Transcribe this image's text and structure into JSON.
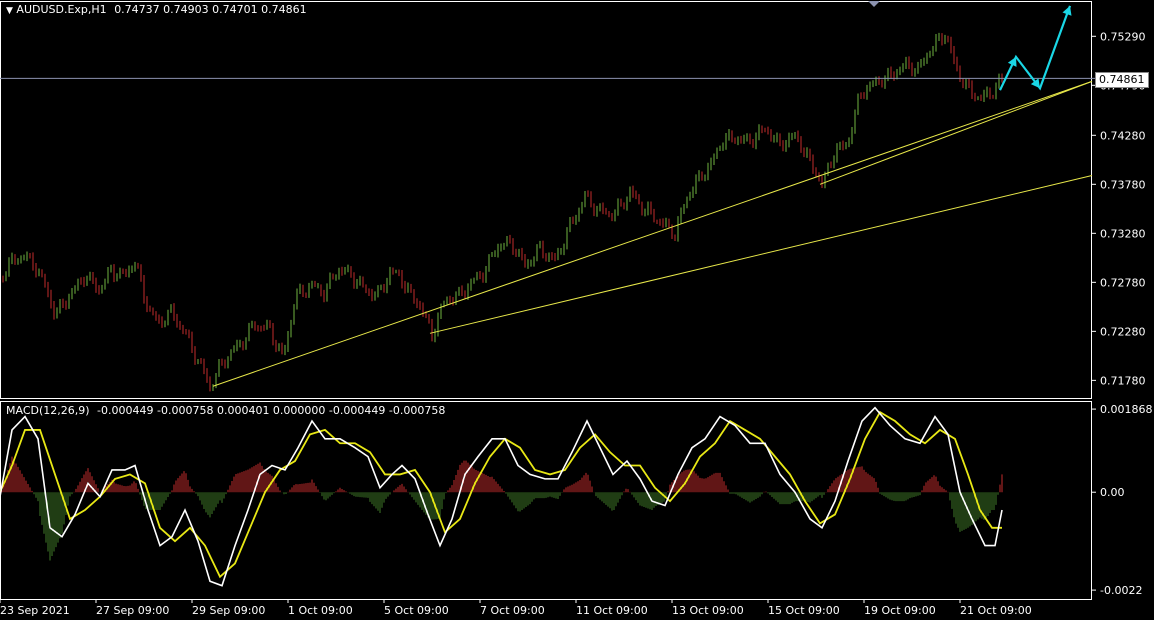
{
  "header": {
    "symbol_timeframe": "AUDUSD.Exp,H1",
    "ohlc": "0.74737 0.74903 0.74701 0.74861"
  },
  "macd_header": {
    "label": "MACD(12,26,9)",
    "values": "-0.000449 -0.000758 0.000401 0.000000 -0.000449 -0.000758"
  },
  "current_price": "0.74861",
  "colors": {
    "background": "#000000",
    "bull": "#6fb43f",
    "bear": "#c22b2b",
    "trendline": "#e8e84a",
    "bid_line": "#8c93b0",
    "arrow": "#1ad7e6",
    "macd_line": "#ffffff",
    "signal_line": "#e8e815",
    "hist_pos": "#c22b2b",
    "hist_neg": "#3f7a28",
    "frame": "#ffffff"
  },
  "chart_data": [
    {
      "type": "candlestick",
      "title": "AUDUSD.Exp,H1",
      "y_ticks": [
        "0.75290",
        "0.74790",
        "0.74280",
        "0.73780",
        "0.73280",
        "0.72780",
        "0.72280",
        "0.71780"
      ],
      "ylim": [
        0.716,
        0.7565
      ],
      "x_ticks": [
        "23 Sep 2021",
        "27 Sep 09:00",
        "29 Sep 09:00",
        "1 Oct 09:00",
        "5 Oct 09:00",
        "7 Oct 09:00",
        "11 Oct 09:00",
        "13 Oct 09:00",
        "15 Oct 09:00",
        "19 Oct 09:00",
        "21 Oct 09:00"
      ],
      "close_path": [
        [
          0,
          0.7282
        ],
        [
          12,
          0.73
        ],
        [
          25,
          0.7305
        ],
        [
          35,
          0.7295
        ],
        [
          45,
          0.7275
        ],
        [
          55,
          0.7245
        ],
        [
          70,
          0.7265
        ],
        [
          85,
          0.7285
        ],
        [
          100,
          0.727
        ],
        [
          110,
          0.729
        ],
        [
          125,
          0.7285
        ],
        [
          135,
          0.73
        ],
        [
          145,
          0.726
        ],
        [
          158,
          0.7235
        ],
        [
          170,
          0.7248
        ],
        [
          182,
          0.7232
        ],
        [
          195,
          0.7205
        ],
        [
          210,
          0.7172
        ],
        [
          225,
          0.72
        ],
        [
          240,
          0.7215
        ],
        [
          255,
          0.7235
        ],
        [
          270,
          0.723
        ],
        [
          283,
          0.72
        ],
        [
          295,
          0.7262
        ],
        [
          310,
          0.7275
        ],
        [
          325,
          0.7268
        ],
        [
          338,
          0.7292
        ],
        [
          352,
          0.7285
        ],
        [
          365,
          0.727
        ],
        [
          378,
          0.7265
        ],
        [
          390,
          0.7288
        ],
        [
          400,
          0.7285
        ],
        [
          410,
          0.7265
        ],
        [
          420,
          0.7255
        ],
        [
          432,
          0.7225
        ],
        [
          445,
          0.726
        ],
        [
          460,
          0.7265
        ],
        [
          472,
          0.7278
        ],
        [
          485,
          0.729
        ],
        [
          497,
          0.7315
        ],
        [
          512,
          0.7318
        ],
        [
          525,
          0.7295
        ],
        [
          540,
          0.7312
        ],
        [
          555,
          0.73
        ],
        [
          570,
          0.7335
        ],
        [
          585,
          0.7365
        ],
        [
          600,
          0.735
        ],
        [
          615,
          0.7348
        ],
        [
          630,
          0.737
        ],
        [
          645,
          0.7352
        ],
        [
          660,
          0.734
        ],
        [
          675,
          0.7328
        ],
        [
          688,
          0.7368
        ],
        [
          700,
          0.7385
        ],
        [
          712,
          0.74
        ],
        [
          722,
          0.7423
        ],
        [
          735,
          0.7425
        ],
        [
          750,
          0.7422
        ],
        [
          765,
          0.7435
        ],
        [
          780,
          0.7418
        ],
        [
          795,
          0.7428
        ],
        [
          808,
          0.7405
        ],
        [
          822,
          0.7378
        ],
        [
          835,
          0.7412
        ],
        [
          848,
          0.742
        ],
        [
          860,
          0.747
        ],
        [
          875,
          0.7482
        ],
        [
          890,
          0.7488
        ],
        [
          905,
          0.75
        ],
        [
          918,
          0.7495
        ],
        [
          930,
          0.7515
        ],
        [
          945,
          0.7532
        ],
        [
          955,
          0.75
        ],
        [
          965,
          0.7478
        ],
        [
          980,
          0.7465
        ],
        [
          995,
          0.7475
        ],
        [
          1002,
          0.7486
        ]
      ],
      "projection": [
        [
          1000,
          0.7474
        ],
        [
          1016,
          0.7508
        ],
        [
          1040,
          0.7476
        ],
        [
          1070,
          0.756
        ]
      ],
      "trendlines": [
        [
          [
            213,
            0.7172
          ],
          [
            1092,
            0.7483
          ]
        ],
        [
          [
            430,
            0.7226
          ],
          [
            1092,
            0.7387
          ]
        ],
        [
          [
            820,
            0.7378
          ],
          [
            1092,
            0.7483
          ]
        ]
      ]
    },
    {
      "type": "macd",
      "title": "MACD(12,26,9)",
      "y_ticks": [
        "0.001868",
        "0.00",
        "-0.0022"
      ],
      "ylim": [
        -0.0024,
        0.00205
      ],
      "macd": [
        [
          0,
          -0.0001
        ],
        [
          12,
          0.0014
        ],
        [
          25,
          0.0017
        ],
        [
          38,
          0.0012
        ],
        [
          50,
          -0.0008
        ],
        [
          62,
          -0.001
        ],
        [
          75,
          -0.0005
        ],
        [
          88,
          0.0002
        ],
        [
          100,
          -0.0001
        ],
        [
          112,
          0.0005
        ],
        [
          125,
          0.0005
        ],
        [
          135,
          0.0006
        ],
        [
          148,
          -0.0004
        ],
        [
          160,
          -0.0012
        ],
        [
          172,
          -0.001
        ],
        [
          185,
          -0.0004
        ],
        [
          198,
          -0.0011
        ],
        [
          210,
          -0.002
        ],
        [
          222,
          -0.0021
        ],
        [
          235,
          -0.0012
        ],
        [
          248,
          -0.0004
        ],
        [
          260,
          0.0004
        ],
        [
          272,
          0.0006
        ],
        [
          285,
          0.0005
        ],
        [
          298,
          0.001
        ],
        [
          312,
          0.0016
        ],
        [
          325,
          0.0012
        ],
        [
          340,
          0.0012
        ],
        [
          355,
          0.001
        ],
        [
          368,
          0.0008
        ],
        [
          380,
          0.0001
        ],
        [
          392,
          0.0004
        ],
        [
          402,
          0.0006
        ],
        [
          415,
          0.0003
        ],
        [
          428,
          -0.0005
        ],
        [
          440,
          -0.0012
        ],
        [
          452,
          -0.0006
        ],
        [
          465,
          0.0004
        ],
        [
          478,
          0.0008
        ],
        [
          492,
          0.0012
        ],
        [
          505,
          0.0012
        ],
        [
          518,
          0.0006
        ],
        [
          530,
          0.0004
        ],
        [
          545,
          0.0003
        ],
        [
          558,
          0.0003
        ],
        [
          572,
          0.0009
        ],
        [
          587,
          0.0016
        ],
        [
          600,
          0.001
        ],
        [
          613,
          0.0004
        ],
        [
          627,
          0.0007
        ],
        [
          640,
          0.0003
        ],
        [
          652,
          -0.0002
        ],
        [
          665,
          -0.0003
        ],
        [
          678,
          0.0004
        ],
        [
          692,
          0.001
        ],
        [
          705,
          0.0012
        ],
        [
          720,
          0.0017
        ],
        [
          735,
          0.0015
        ],
        [
          750,
          0.0011
        ],
        [
          765,
          0.0011
        ],
        [
          780,
          0.0004
        ],
        [
          795,
          0.0
        ],
        [
          810,
          -0.0006
        ],
        [
          822,
          -0.0008
        ],
        [
          835,
          -0.0002
        ],
        [
          848,
          0.0007
        ],
        [
          862,
          0.0016
        ],
        [
          875,
          0.0019
        ],
        [
          890,
          0.0015
        ],
        [
          905,
          0.0012
        ],
        [
          920,
          0.0011
        ],
        [
          935,
          0.0017
        ],
        [
          948,
          0.0013
        ],
        [
          960,
          0.0
        ],
        [
          972,
          -0.0006
        ],
        [
          985,
          -0.0012
        ],
        [
          995,
          -0.0012
        ],
        [
          1002,
          -0.0004
        ]
      ],
      "signal": [
        [
          0,
          0.0
        ],
        [
          12,
          0.0006
        ],
        [
          25,
          0.0014
        ],
        [
          40,
          0.0014
        ],
        [
          55,
          0.0004
        ],
        [
          70,
          -0.0006
        ],
        [
          85,
          -0.0004
        ],
        [
          100,
          -0.0001
        ],
        [
          115,
          0.0003
        ],
        [
          130,
          0.0004
        ],
        [
          145,
          0.0002
        ],
        [
          160,
          -0.0008
        ],
        [
          175,
          -0.0011
        ],
        [
          190,
          -0.0008
        ],
        [
          205,
          -0.0012
        ],
        [
          220,
          -0.0019
        ],
        [
          235,
          -0.0016
        ],
        [
          250,
          -0.0008
        ],
        [
          265,
          0.0
        ],
        [
          280,
          0.0005
        ],
        [
          295,
          0.0007
        ],
        [
          310,
          0.0013
        ],
        [
          325,
          0.0014
        ],
        [
          340,
          0.0011
        ],
        [
          355,
          0.0011
        ],
        [
          370,
          0.0009
        ],
        [
          385,
          0.0004
        ],
        [
          400,
          0.0004
        ],
        [
          415,
          0.0005
        ],
        [
          430,
          0.0
        ],
        [
          445,
          -0.0009
        ],
        [
          460,
          -0.0006
        ],
        [
          475,
          0.0002
        ],
        [
          490,
          0.0008
        ],
        [
          505,
          0.0012
        ],
        [
          520,
          0.001
        ],
        [
          535,
          0.0005
        ],
        [
          550,
          0.0004
        ],
        [
          565,
          0.0005
        ],
        [
          580,
          0.001
        ],
        [
          595,
          0.0013
        ],
        [
          610,
          0.0009
        ],
        [
          625,
          0.0006
        ],
        [
          640,
          0.0006
        ],
        [
          655,
          0.0001
        ],
        [
          670,
          -0.0002
        ],
        [
          685,
          0.0002
        ],
        [
          700,
          0.0008
        ],
        [
          715,
          0.0011
        ],
        [
          730,
          0.0016
        ],
        [
          745,
          0.0014
        ],
        [
          760,
          0.0012
        ],
        [
          775,
          0.0008
        ],
        [
          790,
          0.0004
        ],
        [
          805,
          -0.0002
        ],
        [
          820,
          -0.0007
        ],
        [
          835,
          -0.0005
        ],
        [
          850,
          0.0003
        ],
        [
          865,
          0.0012
        ],
        [
          880,
          0.0018
        ],
        [
          895,
          0.0016
        ],
        [
          910,
          0.0013
        ],
        [
          925,
          0.0011
        ],
        [
          940,
          0.0014
        ],
        [
          955,
          0.0012
        ],
        [
          968,
          0.0004
        ],
        [
          980,
          -0.0004
        ],
        [
          992,
          -0.0008
        ],
        [
          1002,
          -0.0008
        ]
      ]
    }
  ]
}
